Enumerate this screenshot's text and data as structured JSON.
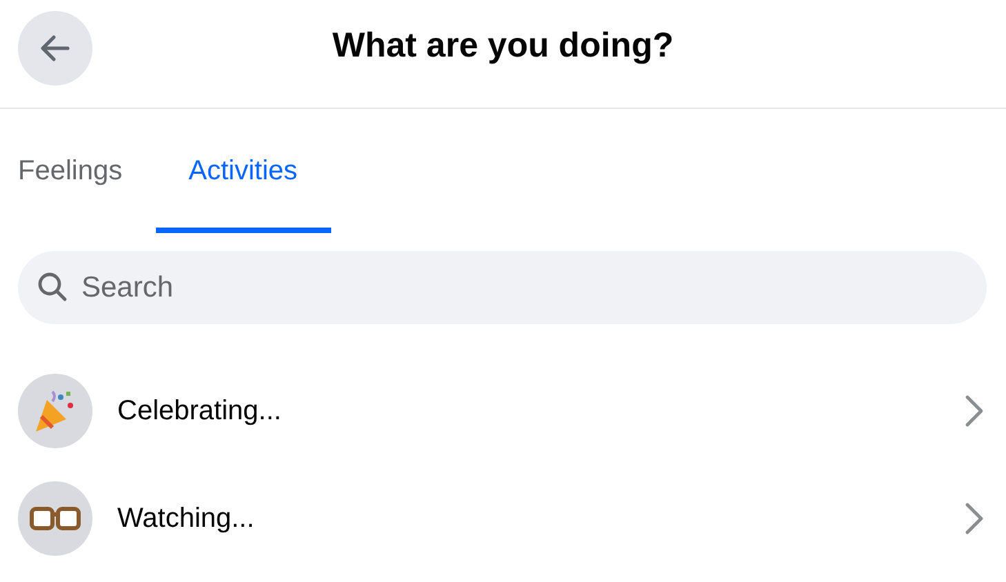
{
  "header": {
    "title": "What are you doing?"
  },
  "tabs": [
    {
      "label": "Feelings",
      "selected": false
    },
    {
      "label": "Activities",
      "selected": true
    }
  ],
  "search": {
    "placeholder": "Search"
  },
  "activities": [
    {
      "kind": "party",
      "label": "Celebrating..."
    },
    {
      "kind": "glasses",
      "label": "Watching..."
    }
  ]
}
